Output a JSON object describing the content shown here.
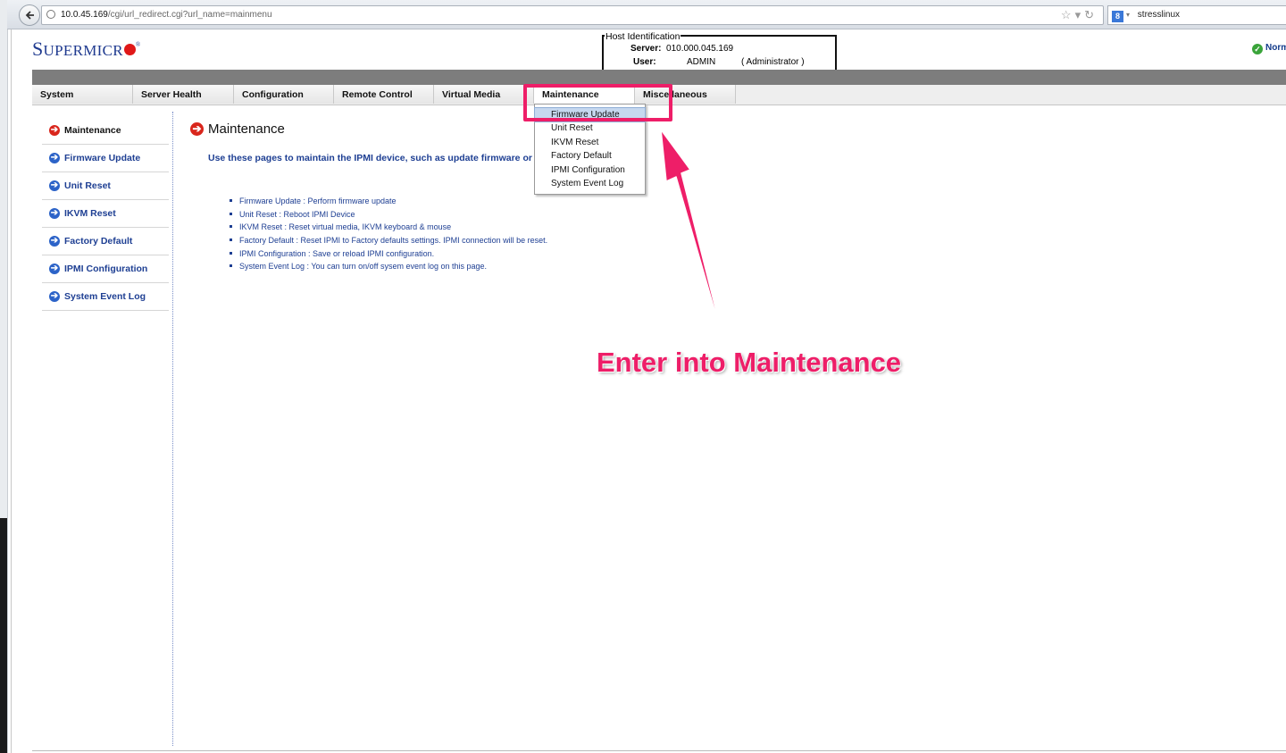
{
  "browser": {
    "url_host": "10.0.45.169",
    "url_path": "/cgi/url_redirect.cgi?url_name=mainmenu",
    "search_text": "stresslinux",
    "search_engine_letter": "8"
  },
  "header": {
    "logo_first": "S",
    "logo_rest": "UPERMICR",
    "host_box": {
      "legend": "Host Identification",
      "server_label": "Server:",
      "server_value": "010.000.045.169",
      "user_label": "User:",
      "user_value": "ADMIN",
      "role": "( Administrator )"
    },
    "status_text": "Norm"
  },
  "nav": {
    "tabs": [
      {
        "label": "System"
      },
      {
        "label": "Server Health"
      },
      {
        "label": "Configuration"
      },
      {
        "label": "Remote Control"
      },
      {
        "label": "Virtual Media"
      },
      {
        "label": "Maintenance"
      },
      {
        "label": "Miscellaneous"
      }
    ],
    "active_tab": "Maintenance"
  },
  "dropdown": {
    "items": [
      {
        "label": "Firmware Update"
      },
      {
        "label": "Unit Reset"
      },
      {
        "label": "IKVM Reset"
      },
      {
        "label": "Factory Default"
      },
      {
        "label": "IPMI Configuration"
      },
      {
        "label": "System Event Log"
      }
    ],
    "hovered": "Firmware Update"
  },
  "sidebar": {
    "items": [
      {
        "label": "Maintenance"
      },
      {
        "label": "Firmware Update"
      },
      {
        "label": "Unit Reset"
      },
      {
        "label": "IKVM Reset"
      },
      {
        "label": "Factory Default"
      },
      {
        "label": "IPMI Configuration"
      },
      {
        "label": "System Event Log"
      }
    ],
    "active": "Maintenance"
  },
  "main": {
    "title": "Maintenance",
    "intro": "Use these pages to maintain the IPMI device, such as update firmware or re",
    "list": [
      "Firmware Update : Perform firmware update",
      "Unit Reset : Reboot IPMI Device",
      "IKVM Reset : Reset virtual media, IKVM keyboard & mouse",
      "Factory Default : Reset IPMI to Factory defaults settings. IPMI connection will be reset.",
      "IPMI Configuration : Save or reload IPMI configuration.",
      "System Event Log : You can turn on/off sysem event log on this page."
    ]
  },
  "annotation": {
    "text": "Enter into Maintenance",
    "color": "#ee1e68"
  },
  "colors": {
    "link_blue": "#1e3f93",
    "logo_blue": "#1f3a8f",
    "logo_red": "#e01818",
    "nav_band": "#7d7d7d",
    "hover_bg": "#c6d8ef"
  }
}
